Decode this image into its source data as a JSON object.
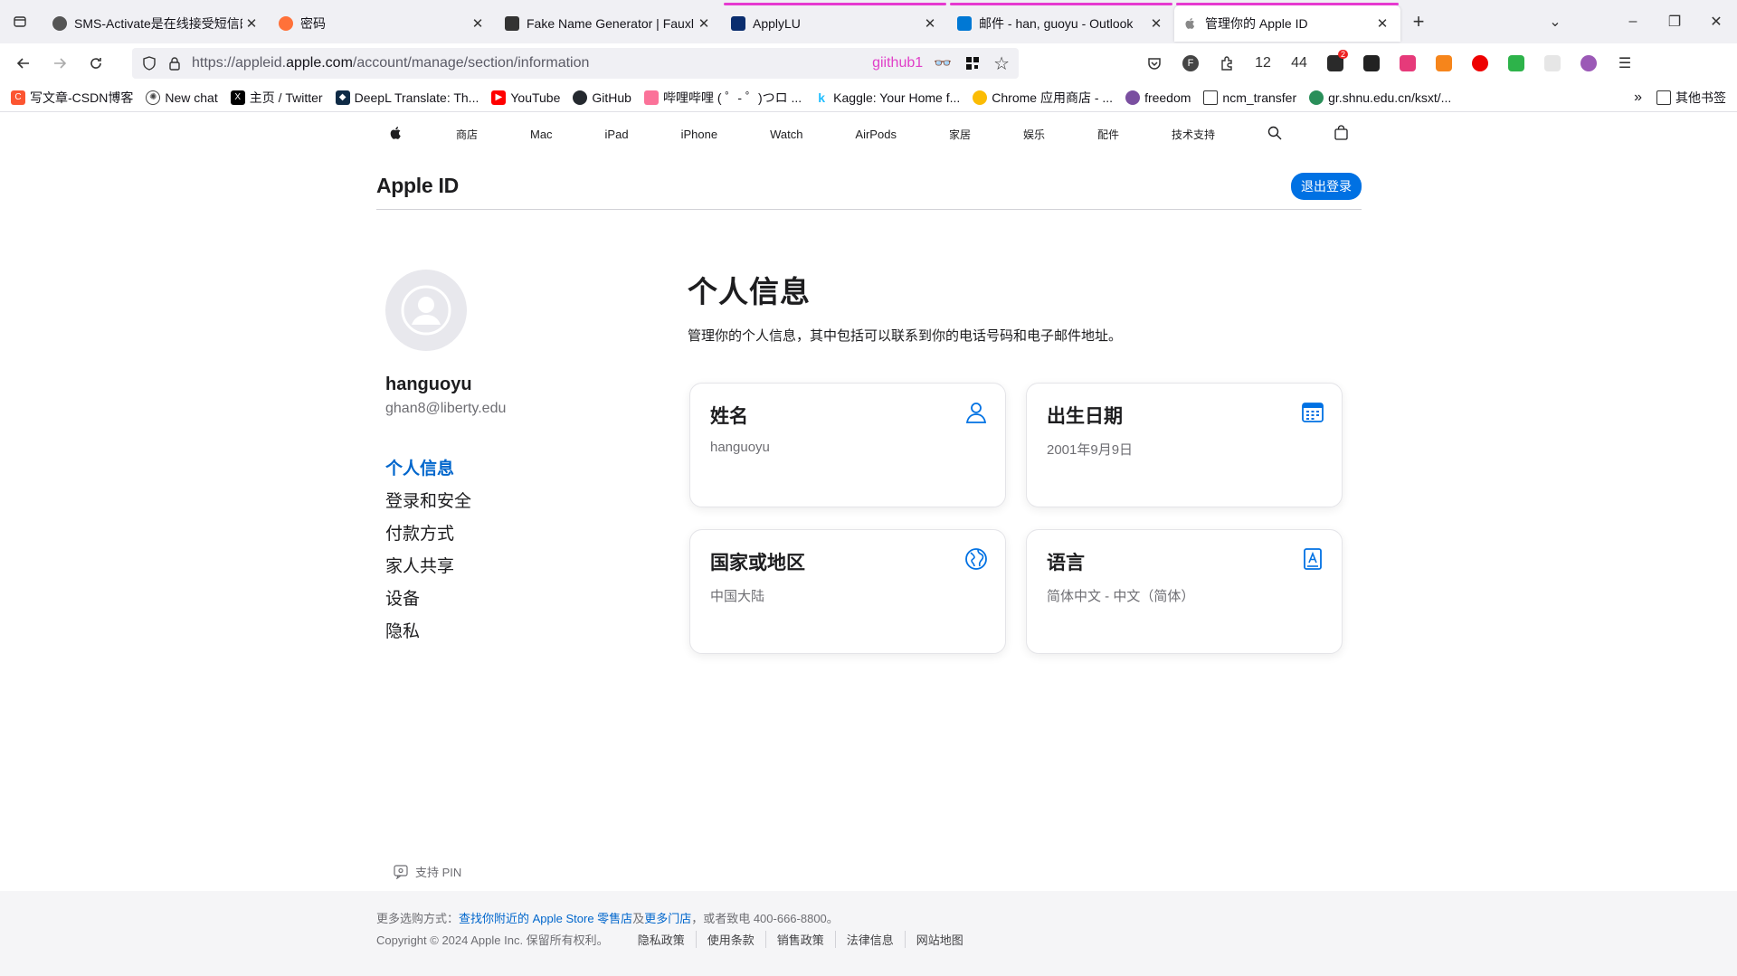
{
  "browser": {
    "tabs": [
      {
        "title": "SMS-Activate是在线接受短信的",
        "favicon_color": "#555555",
        "active": false,
        "pink": false
      },
      {
        "title": "密码",
        "favicon_color": "#ff7139",
        "active": false,
        "pink": false
      },
      {
        "title": "Fake Name Generator | Fauxl",
        "favicon_color": "#333333",
        "active": false,
        "pink": false
      },
      {
        "title": "ApplyLU",
        "favicon_color": "#0a2d6e",
        "active": false,
        "pink": true
      },
      {
        "title": "邮件 - han, guoyu - Outlook",
        "favicon_color": "#0078d4",
        "active": false,
        "pink": true
      },
      {
        "title": "管理你的 Apple ID",
        "favicon_color": "#888888",
        "active": true,
        "pink": true
      }
    ],
    "new_tab": "+",
    "url_prefix": "https://appleid.",
    "url_domain": "apple.com",
    "url_path": "/account/manage/section/information",
    "url_extra": "giithub1",
    "ext_counts": [
      "12",
      "44"
    ],
    "ext_badge": "2",
    "bookmarks": [
      {
        "label": "写文章-CSDN博客",
        "color": "#fc5531"
      },
      {
        "label": "New chat",
        "color": "#444444"
      },
      {
        "label": "主页 / Twitter",
        "color": "#000000"
      },
      {
        "label": "DeepL Translate: Th...",
        "color": "#0f2b46"
      },
      {
        "label": "YouTube",
        "color": "#ff0000"
      },
      {
        "label": "GitHub",
        "color": "#24292f"
      },
      {
        "label": "哔哩哔哩 ( ゜- ゜)つロ ...",
        "color": "#fb7299"
      },
      {
        "label": "Kaggle: Your Home f...",
        "color": "#20beff"
      },
      {
        "label": "Chrome 应用商店 - ...",
        "color": "#fbbc04"
      },
      {
        "label": "freedom",
        "color": "#7a4fa0"
      },
      {
        "label": "ncm_transfer",
        "color": "#ffffff"
      },
      {
        "label": "gr.shnu.edu.cn/ksxt/...",
        "color": "#2a8f5a"
      }
    ],
    "other_bookmarks": "其他书签"
  },
  "globalnav": [
    "商店",
    "Mac",
    "iPad",
    "iPhone",
    "Watch",
    "AirPods",
    "家居",
    "娱乐",
    "配件",
    "技术支持"
  ],
  "header": {
    "title": "Apple ID",
    "signout": "退出登录"
  },
  "user": {
    "name": "hanguoyu",
    "email": "ghan8@liberty.edu"
  },
  "menu": [
    "个人信息",
    "登录和安全",
    "付款方式",
    "家人共享",
    "设备",
    "隐私"
  ],
  "main": {
    "title": "个人信息",
    "desc": "管理你的个人信息，其中包括可以联系到你的电话号码和电子邮件地址。"
  },
  "cards": [
    {
      "title": "姓名",
      "value": "hanguoyu",
      "icon": "person-icon"
    },
    {
      "title": "出生日期",
      "value": "2001年9月9日",
      "icon": "calendar-icon"
    },
    {
      "title": "国家或地区",
      "value": "中国大陆",
      "icon": "globe-icon"
    },
    {
      "title": "语言",
      "value": "简体中文 - 中文（简体）",
      "icon": "language-icon"
    }
  ],
  "pin": "支持 PIN",
  "footer": {
    "prefix": "更多选购方式：",
    "link1": "查找你附近的 Apple Store 零售店",
    "mid": "及",
    "link2": "更多门店",
    "suffix": "，或者致电 400-666-8800。",
    "copyright": "Copyright © 2024 Apple Inc. 保留所有权利。",
    "links": [
      "隐私政策",
      "使用条款",
      "销售政策",
      "法律信息",
      "网站地图"
    ]
  },
  "colors": {
    "accent": "#0071e3",
    "link": "#0066cc",
    "tab_indicator": "#e63ad0"
  }
}
